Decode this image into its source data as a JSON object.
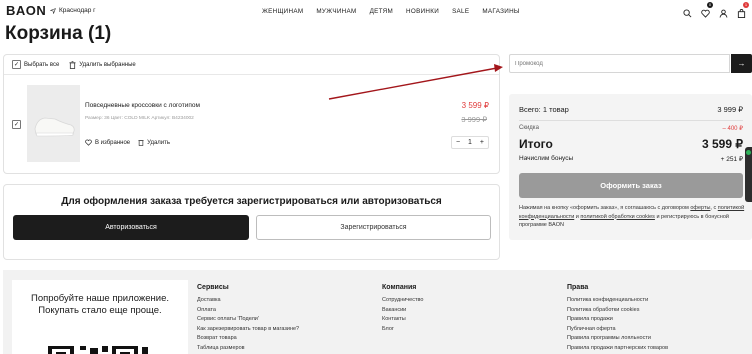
{
  "header": {
    "logo": "BAON",
    "city": "Краснодар г",
    "nav": [
      "ЖЕНЩИНАМ",
      "МУЖЧИНАМ",
      "ДЕТЯМ",
      "НОВИНКИ",
      "SALE",
      "МАГАЗИНЫ"
    ],
    "icons": [
      "search-icon",
      "heart-icon",
      "user-icon",
      "bag-icon"
    ],
    "favorites_count": "0",
    "cart_count": "1"
  },
  "page_title": "Корзина (1)",
  "cart": {
    "select_all": "Выбрать все",
    "delete_selected": "Удалить выбранные",
    "item": {
      "name": "Повседневные кроссовки с логотипом",
      "meta": "Размер: 36   Цвет: COLD MILK   Артикул: B4234002",
      "price_now": "3 599 ₽",
      "price_old": "3 999 ₽",
      "favorite": "В избранное",
      "delete": "Удалить",
      "qty_minus": "−",
      "qty": "1",
      "qty_plus": "+"
    }
  },
  "auth": {
    "title": "Для оформления заказа требуется зарегистрироваться или авторизоваться",
    "login": "Авторизоваться",
    "register": "Зарегистрироваться"
  },
  "promo": {
    "placeholder": "Промокод",
    "button": "→"
  },
  "summary": {
    "total_label": "Всего: 1 товар",
    "total_value": "3 999 ₽",
    "discount_label": "Скидка",
    "discount_value": "– 400 ₽",
    "final_label": "Итого",
    "final_value": "3 599 ₽",
    "bonus_label": "Начислим бонусы",
    "bonus_value": "+ 251 ₽",
    "checkout": "Оформить заказ",
    "legal_1": "Нажимая на кнопку «оформить заказ», я соглашаюсь с договором ",
    "legal_offer": "оферты",
    "legal_2": ", с ",
    "legal_privacy": "политикой конфиденциальности",
    "legal_3": " и ",
    "legal_cookies": "политикой обработки cookies",
    "legal_4": " и регистрируюсь в бонусной программе BAON"
  },
  "footer": {
    "app_promo": "Попробуйте наше приложение. Покупать стало еще проще.",
    "services": {
      "title": "Сервисы",
      "links": [
        "Доставка",
        "Оплата",
        "Сервис оплаты 'Подели'",
        "Как зарезервировать товар в магазине?",
        "Возврат товара",
        "Таблица размеров"
      ]
    },
    "company": {
      "title": "Компания",
      "links": [
        "Сотрудничество",
        "Вакансии",
        "Контакты",
        "Блог"
      ]
    },
    "rights": {
      "title": "Права",
      "links": [
        "Политика конфиденциальности",
        "Политика обработки cookies",
        "Правила продажи",
        "Публичная оферта",
        "Правила программы лояльности",
        "Правила продажи партнерских товаров"
      ]
    }
  },
  "colors": {
    "accent_red": "#e03a3a",
    "dark": "#1c1c1c",
    "disabled_button": "#9a9a9a"
  }
}
